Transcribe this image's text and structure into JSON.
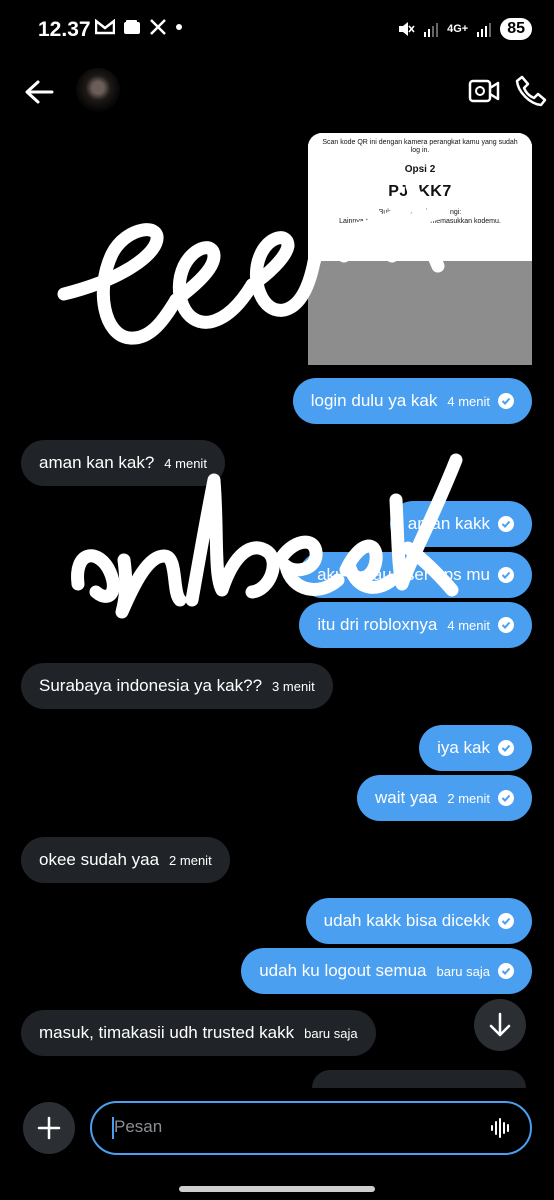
{
  "status_bar": {
    "time": "12.37",
    "notif_icons": [
      "gmail-icon",
      "wallet-icon",
      "x-icon",
      "dot-icon"
    ],
    "network": "4G+",
    "battery": "85"
  },
  "header": {
    "back_icon": "arrow-left-icon",
    "video_icon": "video-call-icon",
    "call_icon": "phone-icon"
  },
  "qr_image": {
    "instruction": "Scan kode QR ini dengan kamera perangkat kamu yang sudah log in.",
    "option_title": "Opsi 2",
    "code": "PJ7KK7",
    "line1": "Buka Roblox lalu kunjungi:",
    "line2": "Lainnya > Login Cepat untuk memasukkan kodemu."
  },
  "messages": [
    {
      "dir": "out",
      "text": "login dulu ya kak",
      "time": "4 menit",
      "read": true
    },
    {
      "dir": "in",
      "text": "aman kan kak?",
      "time": "4 menit"
    },
    {
      "dir": "out",
      "text": "aman kakk",
      "time": "",
      "read": true
    },
    {
      "dir": "out",
      "text": "aku gatau user / ps mu",
      "time": "",
      "read": true
    },
    {
      "dir": "out",
      "text": "itu dri robloxnya",
      "time": "4 menit",
      "read": true
    },
    {
      "dir": "in",
      "text": "Surabaya indonesia ya kak??",
      "time": "3 menit"
    },
    {
      "dir": "out",
      "text": "iya kak",
      "time": "",
      "read": true
    },
    {
      "dir": "out",
      "text": "wait yaa",
      "time": "2 menit",
      "read": true
    },
    {
      "dir": "in",
      "text": "okee sudah yaa",
      "time": "2 menit"
    },
    {
      "dir": "out",
      "text": "udah kakk bisa dicekk",
      "time": "",
      "read": true
    },
    {
      "dir": "out",
      "text": "udah ku logout semua",
      "time": "baru saja",
      "read": true
    },
    {
      "dir": "in",
      "text": "masuk, timakasii udh trusted kakk",
      "time": "baru saja"
    }
  ],
  "composer": {
    "placeholder": "Pesan",
    "add_icon": "plus-icon",
    "voice_icon": "voice-wave-icon",
    "scroll_icon": "arrow-down-icon"
  },
  "colors": {
    "outgoing": "#4a9ff0",
    "incoming": "#202327",
    "background": "#000000"
  }
}
